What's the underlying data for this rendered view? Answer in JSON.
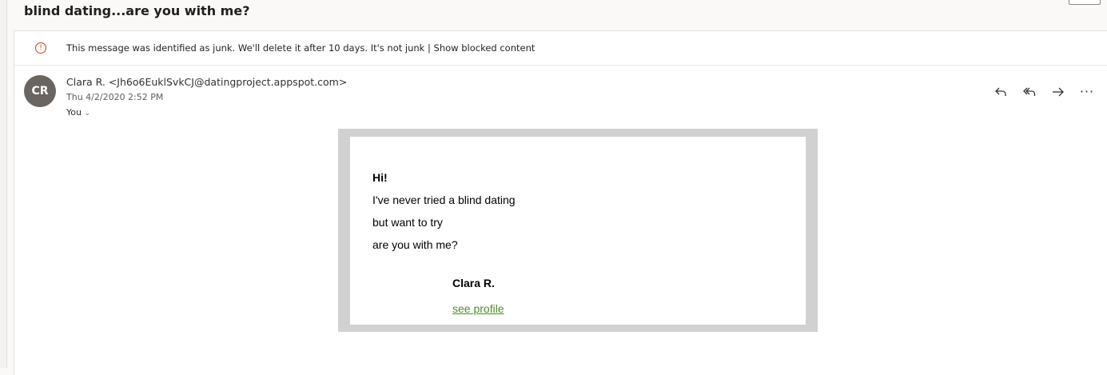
{
  "message": {
    "subject": "blind dating...are you with me?"
  },
  "junk_bar": {
    "notice": "This message was identified as junk. We'll delete it after 10 days.",
    "not_junk_label": "It's not junk",
    "separator": "|",
    "show_blocked_label": "Show blocked content",
    "icon_glyph": "!"
  },
  "header": {
    "avatar_initials": "CR",
    "sender": "Clara R. <Jh6o6EuklSvkCJ@datingproject.appspot.com>",
    "date": "Thu 4/2/2020 2:52 PM",
    "recipient": "You",
    "recipient_chevron": "⌄"
  },
  "actions": {
    "more_label": "···",
    "icons": [
      "reply-icon",
      "reply-all-icon",
      "forward-icon",
      "more-options-icon"
    ]
  },
  "body": {
    "greeting": "Hi!",
    "lines": [
      "I've never tried a blind dating",
      "but want to try",
      "are you with me?"
    ],
    "signature": "Clara R.",
    "link_label": "see profile"
  },
  "colors": {
    "avatar_bg": "#6b6561",
    "link": "#4f8a2d",
    "warning": "#c4401a",
    "frame": "#d1d1d1"
  }
}
